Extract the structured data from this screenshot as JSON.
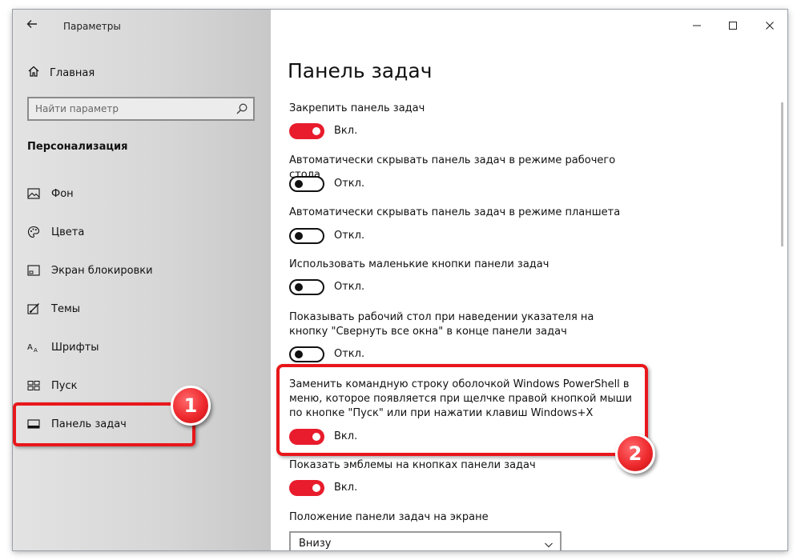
{
  "window": {
    "title": "Параметры",
    "controls": [
      "minimize",
      "maximize",
      "close"
    ]
  },
  "sidebar": {
    "home_label": "Главная",
    "search_placeholder": "Найти параметр",
    "section_title": "Персонализация",
    "items": [
      {
        "label": "Фон",
        "icon": "image-icon"
      },
      {
        "label": "Цвета",
        "icon": "palette-icon"
      },
      {
        "label": "Экран блокировки",
        "icon": "lock-screen-icon"
      },
      {
        "label": "Темы",
        "icon": "themes-icon"
      },
      {
        "label": "Шрифты",
        "icon": "fonts-icon"
      },
      {
        "label": "Пуск",
        "icon": "start-icon"
      },
      {
        "label": "Панель задач",
        "icon": "taskbar-icon",
        "selected": true
      }
    ]
  },
  "main": {
    "title": "Панель задач",
    "settings": [
      {
        "label": "Закрепить панель задач",
        "state": "Вкл.",
        "on": true
      },
      {
        "label": "Автоматически скрывать панель задач в режиме рабочего стола",
        "state": "Откл.",
        "on": false
      },
      {
        "label": "Автоматически скрывать панель задач в режиме планшета",
        "state": "Откл.",
        "on": false
      },
      {
        "label": "Использовать маленькие кнопки панели задач",
        "state": "Откл.",
        "on": false
      },
      {
        "label": "Показывать рабочий стол при наведении указателя на кнопку \"Свернуть все окна\" в конце панели задач",
        "state": "Откл.",
        "on": false
      },
      {
        "label": "Заменить командную строку оболочкой Windows PowerShell в меню, которое появляется при щелчке правой кнопкой мыши по кнопке \"Пуск\" или при нажатии клавиш Windows+X",
        "state": "Вкл.",
        "on": true
      },
      {
        "label": "Показать эмблемы на кнопках панели задач",
        "state": "Вкл.",
        "on": true
      }
    ],
    "position_label": "Положение панели задач на экране",
    "position_value": "Внизу"
  },
  "annotations": {
    "badge1": "1",
    "badge2": "2"
  },
  "colors": {
    "toggle_on": "#e81c2c",
    "highlight": "#e8171b"
  }
}
